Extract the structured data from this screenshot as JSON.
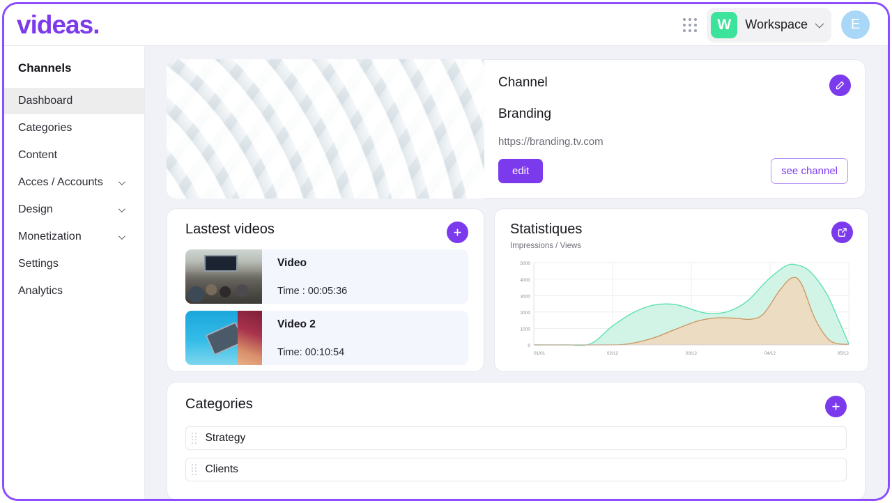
{
  "header": {
    "logo": "videas.",
    "apps_icon": "apps-grid-icon",
    "workspace": {
      "badge": "W",
      "label": "Workspace",
      "chevron_icon": "chevron-down-icon"
    },
    "avatar": {
      "initial": "E"
    }
  },
  "sidebar": {
    "title": "Channels",
    "items": [
      {
        "label": "Dashboard",
        "active": true,
        "expandable": false
      },
      {
        "label": "Categories",
        "active": false,
        "expandable": false
      },
      {
        "label": "Content",
        "active": false,
        "expandable": false
      },
      {
        "label": "Acces / Accounts",
        "active": false,
        "expandable": true
      },
      {
        "label": "Design",
        "active": false,
        "expandable": true
      },
      {
        "label": "Monetization",
        "active": false,
        "expandable": true
      },
      {
        "label": "Settings",
        "active": false,
        "expandable": false
      },
      {
        "label": "Analytics",
        "active": false,
        "expandable": false
      }
    ]
  },
  "channel": {
    "heading": "Channel",
    "name": "Branding",
    "url": "https://branding.tv.com",
    "edit_button": "edit",
    "see_channel_button": "see channel",
    "edit_icon": "pencil-icon",
    "banner_icon": "channel-banner-image"
  },
  "videos": {
    "title": "Lastest videos",
    "add_icon": "plus-icon",
    "items": [
      {
        "title": "Video",
        "time": "Time : 00:05:36",
        "thumb": "conference-room-thumbnail"
      },
      {
        "title": "Video 2",
        "time": "Time: 00:10:54",
        "thumb": "cassette-tape-thumbnail"
      }
    ]
  },
  "statistics": {
    "title": "Statistiques",
    "subtitle": "Impressions / Views",
    "open_icon": "external-link-icon"
  },
  "categories": {
    "title": "Categories",
    "add_icon": "plus-icon",
    "items": [
      {
        "label": "Strategy",
        "grip_icon": "drag-handle-icon"
      },
      {
        "label": "Clients",
        "grip_icon": "drag-handle-icon"
      }
    ]
  },
  "colors": {
    "brand_purple": "#7c3aed",
    "frame_purple": "#8b4dff",
    "workspace_green": "#3be39b",
    "avatar_blue": "#a9d7f7",
    "main_bg": "#f0f2f7",
    "impressions_stroke": "#5fe0b0",
    "impressions_fill": "#d2f4e6",
    "views_stroke": "#cb9a67",
    "views_fill": "#ecdcc2"
  },
  "chart_data": {
    "type": "area",
    "title": "Statistiques",
    "subtitle": "Impressions / Views",
    "xlabel": "",
    "ylabel": "",
    "ylim": [
      0,
      5000
    ],
    "yticks": [
      0,
      1000,
      2000,
      3000,
      4000,
      5000
    ],
    "ytick_labels": [
      "0",
      "1000",
      "2000",
      "3000",
      "4000",
      "5000"
    ],
    "x": [
      "01/01",
      "02/12",
      "03/12",
      "04/12",
      "05/12"
    ],
    "xtick_labels": [
      "01/01",
      "02/12",
      "03/12",
      "04/12",
      "05/12"
    ],
    "grid": true,
    "legend": "none",
    "smooth": true,
    "series": [
      {
        "name": "Impressions",
        "stroke": "#5fe0b0",
        "fill": "#d2f4e6",
        "points": [
          {
            "t": 0.0,
            "v": 0
          },
          {
            "t": 0.1,
            "v": 0
          },
          {
            "t": 0.18,
            "v": 60
          },
          {
            "t": 0.25,
            "v": 1150
          },
          {
            "t": 0.32,
            "v": 2000
          },
          {
            "t": 0.38,
            "v": 2420
          },
          {
            "t": 0.45,
            "v": 2450
          },
          {
            "t": 0.52,
            "v": 2050
          },
          {
            "t": 0.56,
            "v": 1900
          },
          {
            "t": 0.62,
            "v": 2050
          },
          {
            "t": 0.68,
            "v": 2700
          },
          {
            "t": 0.74,
            "v": 3900
          },
          {
            "t": 0.8,
            "v": 4800
          },
          {
            "t": 0.84,
            "v": 4840
          },
          {
            "t": 0.88,
            "v": 4400
          },
          {
            "t": 0.93,
            "v": 3100
          },
          {
            "t": 0.97,
            "v": 1400
          },
          {
            "t": 1.0,
            "v": 60
          }
        ]
      },
      {
        "name": "Views",
        "stroke": "#cb9a67",
        "fill": "#ecdcc2",
        "points": [
          {
            "t": 0.0,
            "v": 0
          },
          {
            "t": 0.22,
            "v": 0
          },
          {
            "t": 0.3,
            "v": 60
          },
          {
            "t": 0.38,
            "v": 420
          },
          {
            "t": 0.45,
            "v": 950
          },
          {
            "t": 0.52,
            "v": 1450
          },
          {
            "t": 0.58,
            "v": 1640
          },
          {
            "t": 0.64,
            "v": 1620
          },
          {
            "t": 0.69,
            "v": 1560
          },
          {
            "t": 0.73,
            "v": 1900
          },
          {
            "t": 0.78,
            "v": 3300
          },
          {
            "t": 0.82,
            "v": 4080
          },
          {
            "t": 0.85,
            "v": 3700
          },
          {
            "t": 0.89,
            "v": 1700
          },
          {
            "t": 0.93,
            "v": 450
          },
          {
            "t": 0.96,
            "v": 90
          },
          {
            "t": 1.0,
            "v": 30
          }
        ]
      }
    ]
  }
}
